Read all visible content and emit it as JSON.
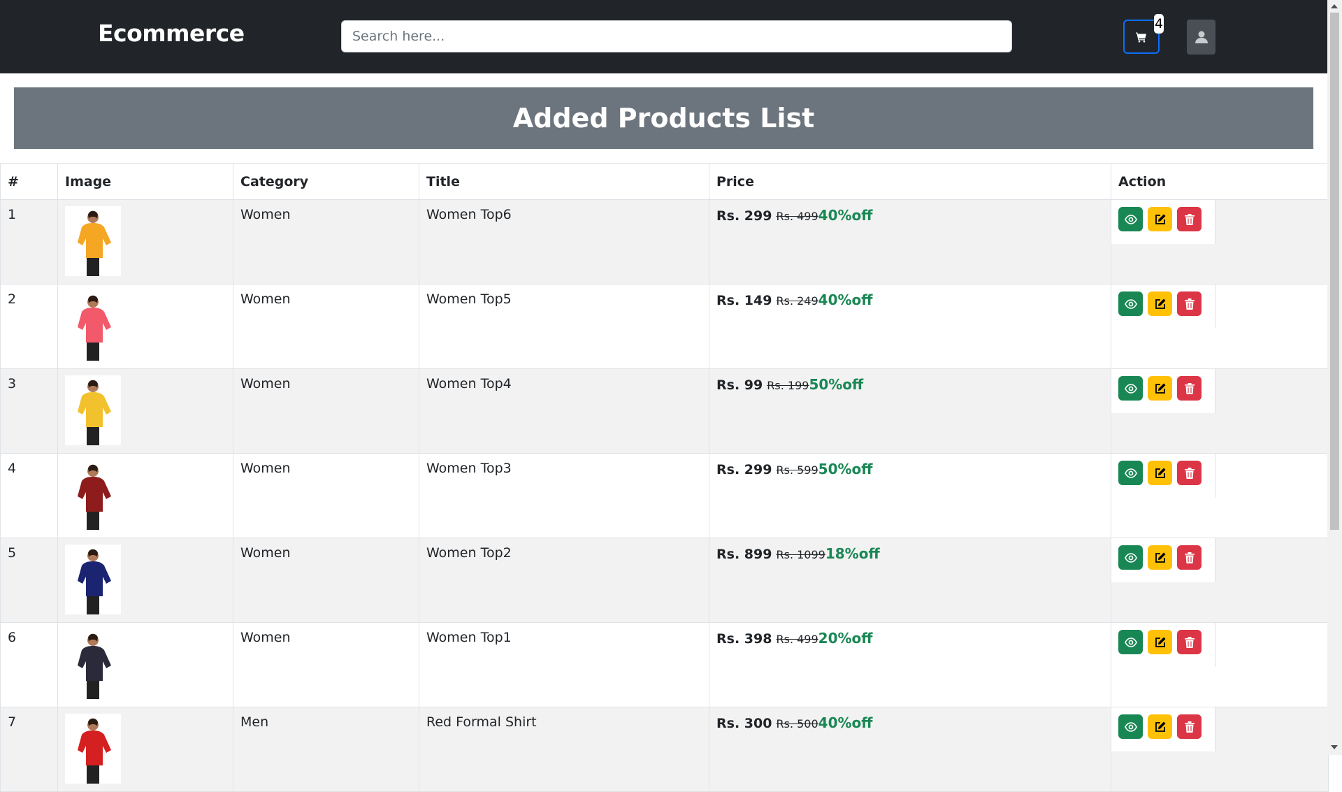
{
  "navbar": {
    "brand": "Ecommerce",
    "search_placeholder": "Search here...",
    "cart_count": "4",
    "cart_icon": "cart-icon",
    "user_icon": "user-icon"
  },
  "banner": {
    "title": "Added Products List"
  },
  "table": {
    "headers": [
      "#",
      "Image",
      "Category",
      "Title",
      "Price",
      "Action"
    ],
    "rows": [
      {
        "num": "1",
        "category": "Women",
        "title": "Women Top6",
        "price": "Rs. 299",
        "old_price": "Rs. 499",
        "discount": "40%off",
        "image_color": "#f5a623"
      },
      {
        "num": "2",
        "category": "Women",
        "title": "Women Top5",
        "price": "Rs. 149",
        "old_price": "Rs. 249",
        "discount": "40%off",
        "image_color": "#f25a6b"
      },
      {
        "num": "3",
        "category": "Women",
        "title": "Women Top4",
        "price": "Rs. 99",
        "old_price": "Rs. 199",
        "discount": "50%off",
        "image_color": "#f2c12e"
      },
      {
        "num": "4",
        "category": "Women",
        "title": "Women Top3",
        "price": "Rs. 299",
        "old_price": "Rs. 599",
        "discount": "50%off",
        "image_color": "#8e1c1c"
      },
      {
        "num": "5",
        "category": "Women",
        "title": "Women Top2",
        "price": "Rs. 899",
        "old_price": "Rs. 1099",
        "discount": "18%off",
        "image_color": "#1a2470"
      },
      {
        "num": "6",
        "category": "Women",
        "title": "Women Top1",
        "price": "Rs. 398",
        "old_price": "Rs. 499",
        "discount": "20%off",
        "image_color": "#2a2a3a"
      },
      {
        "num": "7",
        "category": "Men",
        "title": "Red Formal Shirt",
        "price": "Rs. 300",
        "old_price": "Rs. 500",
        "discount": "40%off",
        "image_color": "#d42020"
      }
    ]
  },
  "colors": {
    "navbar": "#212529",
    "banner": "#6c757d",
    "view_button": "#198754",
    "edit_button": "#ffc107",
    "delete_button": "#dc3545",
    "discount_text": "#198754"
  }
}
